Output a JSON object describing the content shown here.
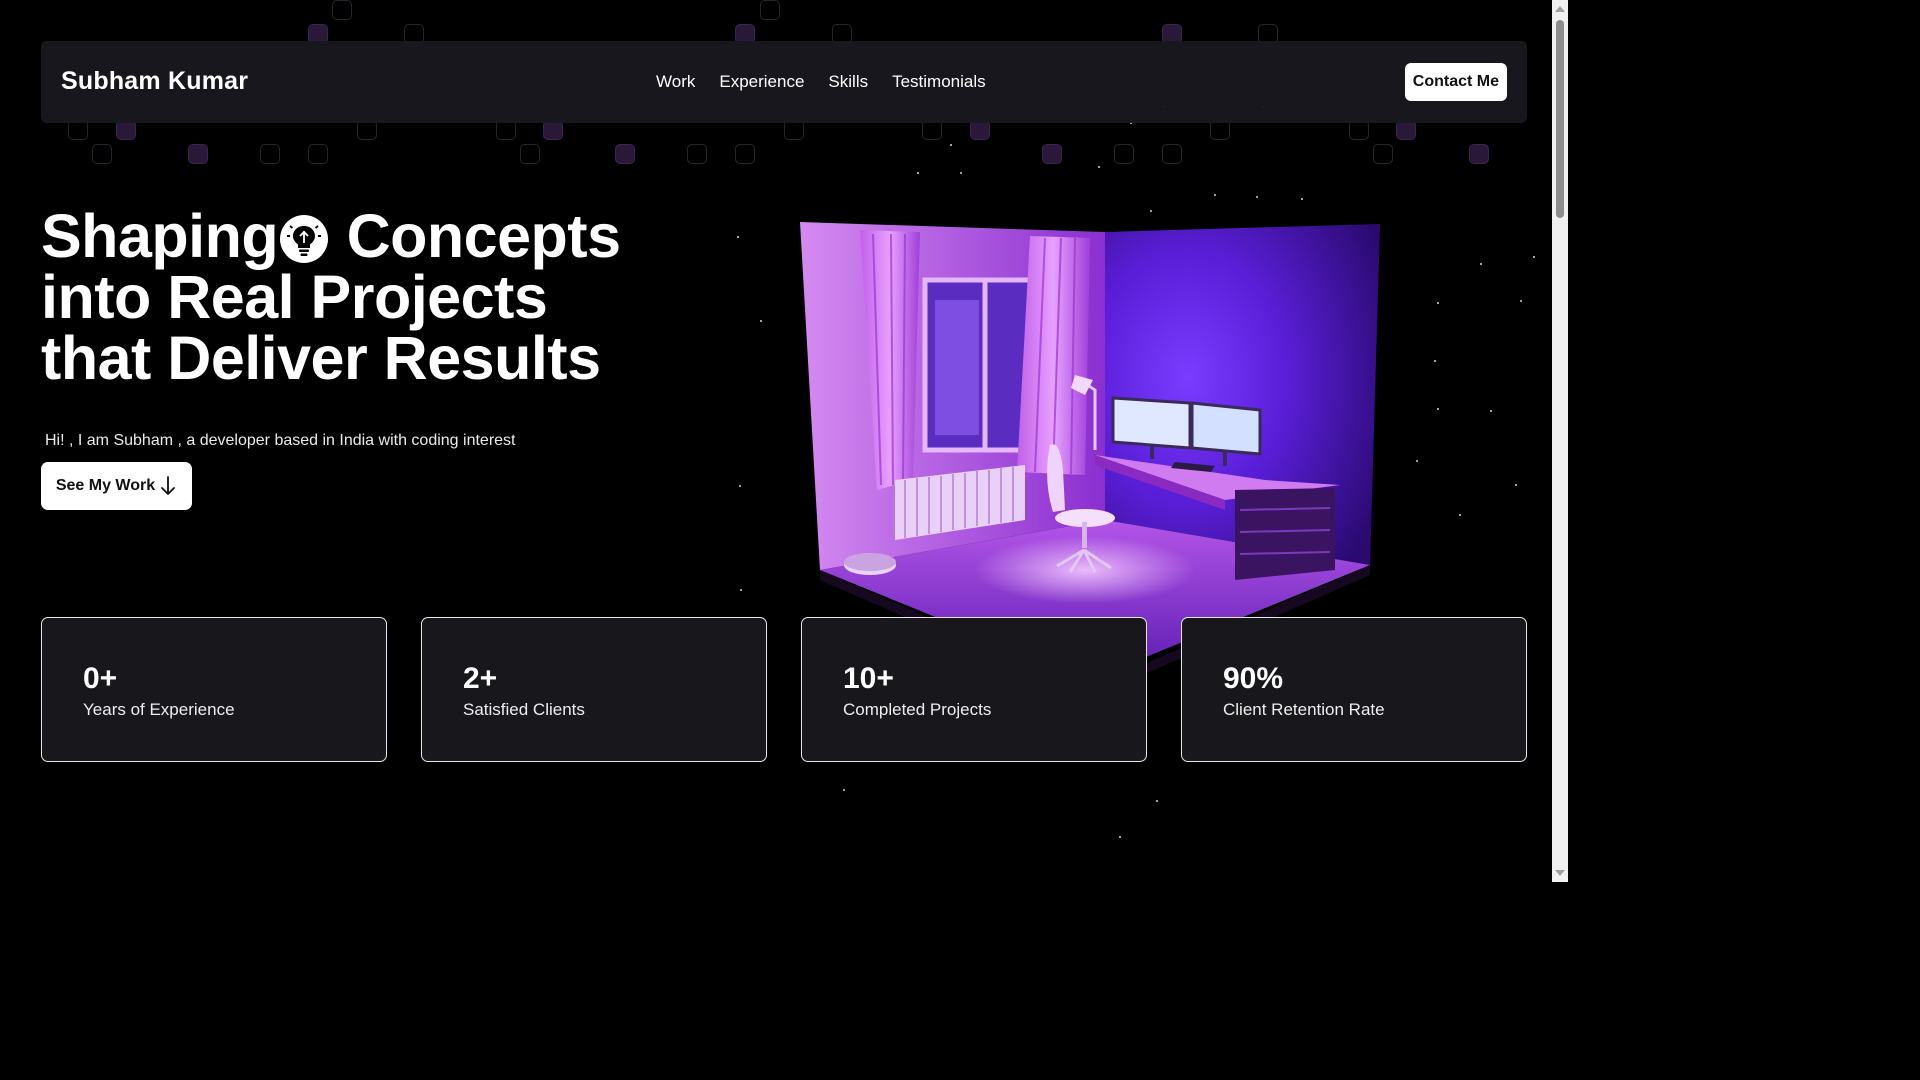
{
  "navbar": {
    "brand": "Subham Kumar",
    "links": [
      "Work",
      "Experience",
      "Skills",
      "Testimonials"
    ],
    "contact_label": "Contact Me"
  },
  "hero": {
    "title_part1": "Shaping",
    "title_part2": "Concepts",
    "title_line2": "into Real Projects",
    "title_line3": "that Deliver Results",
    "subtitle": "Hi! , I am Subham , a developer based in India with coding interest",
    "cta_label": "See My Work"
  },
  "stats": [
    {
      "value": "0+",
      "label": "Years of Experience"
    },
    {
      "value": "2+",
      "label": "Satisfied Clients"
    },
    {
      "value": "10+",
      "label": "Completed Projects"
    },
    {
      "value": "90%",
      "label": "Client Retention Rate"
    }
  ],
  "icons": {
    "hero_inline": "lightbulb-icon",
    "cta": "arrow-down-icon"
  },
  "colors": {
    "background": "#000000",
    "navbar": "#18181e",
    "card": "#17171c",
    "accent": "#b04cff"
  }
}
